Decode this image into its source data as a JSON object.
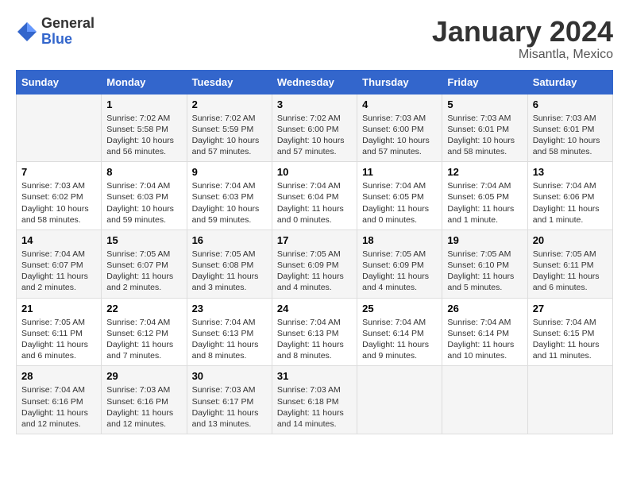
{
  "header": {
    "logo_general": "General",
    "logo_blue": "Blue",
    "main_title": "January 2024",
    "subtitle": "Misantla, Mexico"
  },
  "days_of_week": [
    "Sunday",
    "Monday",
    "Tuesday",
    "Wednesday",
    "Thursday",
    "Friday",
    "Saturday"
  ],
  "weeks": [
    [
      {
        "day": "",
        "info": ""
      },
      {
        "day": "1",
        "info": "Sunrise: 7:02 AM\nSunset: 5:58 PM\nDaylight: 10 hours\nand 56 minutes."
      },
      {
        "day": "2",
        "info": "Sunrise: 7:02 AM\nSunset: 5:59 PM\nDaylight: 10 hours\nand 57 minutes."
      },
      {
        "day": "3",
        "info": "Sunrise: 7:02 AM\nSunset: 6:00 PM\nDaylight: 10 hours\nand 57 minutes."
      },
      {
        "day": "4",
        "info": "Sunrise: 7:03 AM\nSunset: 6:00 PM\nDaylight: 10 hours\nand 57 minutes."
      },
      {
        "day": "5",
        "info": "Sunrise: 7:03 AM\nSunset: 6:01 PM\nDaylight: 10 hours\nand 58 minutes."
      },
      {
        "day": "6",
        "info": "Sunrise: 7:03 AM\nSunset: 6:01 PM\nDaylight: 10 hours\nand 58 minutes."
      }
    ],
    [
      {
        "day": "7",
        "info": "Sunrise: 7:03 AM\nSunset: 6:02 PM\nDaylight: 10 hours\nand 58 minutes."
      },
      {
        "day": "8",
        "info": "Sunrise: 7:04 AM\nSunset: 6:03 PM\nDaylight: 10 hours\nand 59 minutes."
      },
      {
        "day": "9",
        "info": "Sunrise: 7:04 AM\nSunset: 6:03 PM\nDaylight: 10 hours\nand 59 minutes."
      },
      {
        "day": "10",
        "info": "Sunrise: 7:04 AM\nSunset: 6:04 PM\nDaylight: 11 hours\nand 0 minutes."
      },
      {
        "day": "11",
        "info": "Sunrise: 7:04 AM\nSunset: 6:05 PM\nDaylight: 11 hours\nand 0 minutes."
      },
      {
        "day": "12",
        "info": "Sunrise: 7:04 AM\nSunset: 6:05 PM\nDaylight: 11 hours\nand 1 minute."
      },
      {
        "day": "13",
        "info": "Sunrise: 7:04 AM\nSunset: 6:06 PM\nDaylight: 11 hours\nand 1 minute."
      }
    ],
    [
      {
        "day": "14",
        "info": "Sunrise: 7:04 AM\nSunset: 6:07 PM\nDaylight: 11 hours\nand 2 minutes."
      },
      {
        "day": "15",
        "info": "Sunrise: 7:05 AM\nSunset: 6:07 PM\nDaylight: 11 hours\nand 2 minutes."
      },
      {
        "day": "16",
        "info": "Sunrise: 7:05 AM\nSunset: 6:08 PM\nDaylight: 11 hours\nand 3 minutes."
      },
      {
        "day": "17",
        "info": "Sunrise: 7:05 AM\nSunset: 6:09 PM\nDaylight: 11 hours\nand 4 minutes."
      },
      {
        "day": "18",
        "info": "Sunrise: 7:05 AM\nSunset: 6:09 PM\nDaylight: 11 hours\nand 4 minutes."
      },
      {
        "day": "19",
        "info": "Sunrise: 7:05 AM\nSunset: 6:10 PM\nDaylight: 11 hours\nand 5 minutes."
      },
      {
        "day": "20",
        "info": "Sunrise: 7:05 AM\nSunset: 6:11 PM\nDaylight: 11 hours\nand 6 minutes."
      }
    ],
    [
      {
        "day": "21",
        "info": "Sunrise: 7:05 AM\nSunset: 6:11 PM\nDaylight: 11 hours\nand 6 minutes."
      },
      {
        "day": "22",
        "info": "Sunrise: 7:04 AM\nSunset: 6:12 PM\nDaylight: 11 hours\nand 7 minutes."
      },
      {
        "day": "23",
        "info": "Sunrise: 7:04 AM\nSunset: 6:13 PM\nDaylight: 11 hours\nand 8 minutes."
      },
      {
        "day": "24",
        "info": "Sunrise: 7:04 AM\nSunset: 6:13 PM\nDaylight: 11 hours\nand 8 minutes."
      },
      {
        "day": "25",
        "info": "Sunrise: 7:04 AM\nSunset: 6:14 PM\nDaylight: 11 hours\nand 9 minutes."
      },
      {
        "day": "26",
        "info": "Sunrise: 7:04 AM\nSunset: 6:14 PM\nDaylight: 11 hours\nand 10 minutes."
      },
      {
        "day": "27",
        "info": "Sunrise: 7:04 AM\nSunset: 6:15 PM\nDaylight: 11 hours\nand 11 minutes."
      }
    ],
    [
      {
        "day": "28",
        "info": "Sunrise: 7:04 AM\nSunset: 6:16 PM\nDaylight: 11 hours\nand 12 minutes."
      },
      {
        "day": "29",
        "info": "Sunrise: 7:03 AM\nSunset: 6:16 PM\nDaylight: 11 hours\nand 12 minutes."
      },
      {
        "day": "30",
        "info": "Sunrise: 7:03 AM\nSunset: 6:17 PM\nDaylight: 11 hours\nand 13 minutes."
      },
      {
        "day": "31",
        "info": "Sunrise: 7:03 AM\nSunset: 6:18 PM\nDaylight: 11 hours\nand 14 minutes."
      },
      {
        "day": "",
        "info": ""
      },
      {
        "day": "",
        "info": ""
      },
      {
        "day": "",
        "info": ""
      }
    ]
  ]
}
